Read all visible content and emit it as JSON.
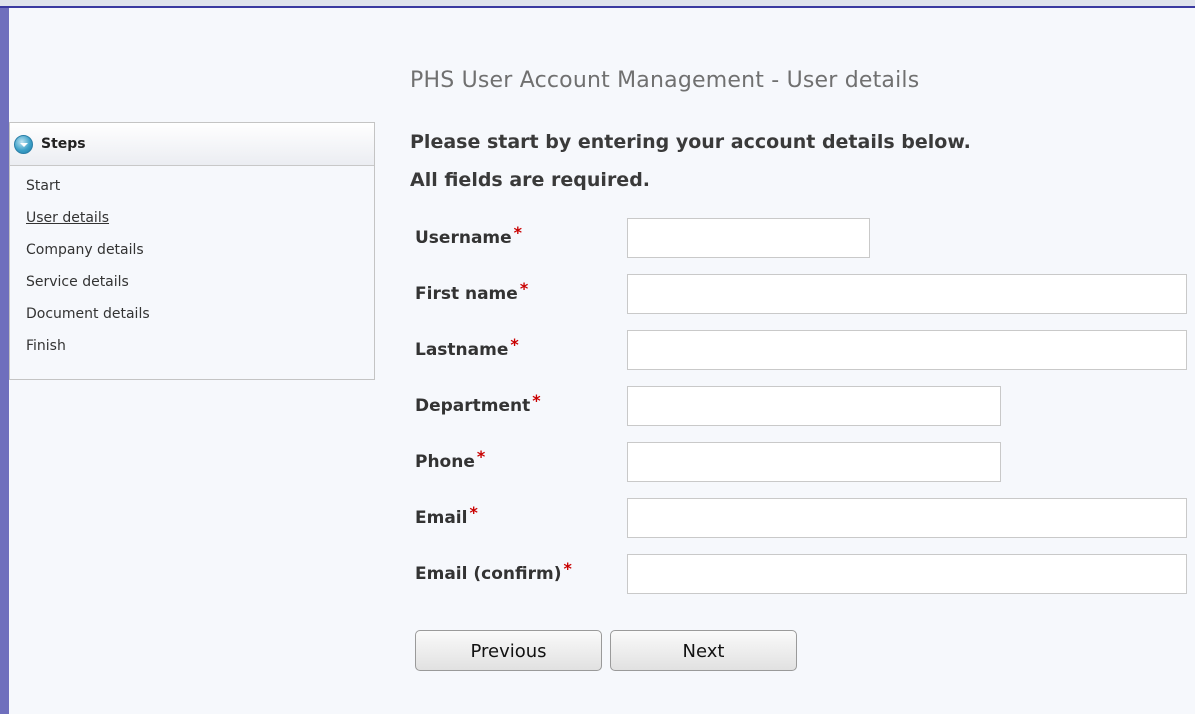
{
  "page": {
    "heading": "PHS User Account Management - User details",
    "intro_line1": "Please start by entering your account details below.",
    "intro_line2": "All fields are required."
  },
  "sidebar": {
    "title": "Steps",
    "items": [
      {
        "label": "Start",
        "current": false
      },
      {
        "label": "User details",
        "current": true
      },
      {
        "label": "Company details",
        "current": false
      },
      {
        "label": "Service details",
        "current": false
      },
      {
        "label": "Document details",
        "current": false
      },
      {
        "label": "Finish",
        "current": false
      }
    ]
  },
  "form": {
    "required_marker": "*",
    "fields": [
      {
        "label": "Username",
        "value": ""
      },
      {
        "label": "First name",
        "value": ""
      },
      {
        "label": "Lastname",
        "value": ""
      },
      {
        "label": "Department",
        "value": ""
      },
      {
        "label": "Phone",
        "value": ""
      },
      {
        "label": "Email",
        "value": ""
      },
      {
        "label": "Email (confirm)",
        "value": ""
      }
    ]
  },
  "buttons": {
    "previous_label": "Previous",
    "next_label": "Next"
  },
  "colors": {
    "required": "#c90000",
    "outer_frame": "#6f6fbd",
    "page_background": "#f6f8fc"
  },
  "icons": {
    "steps_header": "collapse-circle-icon"
  }
}
